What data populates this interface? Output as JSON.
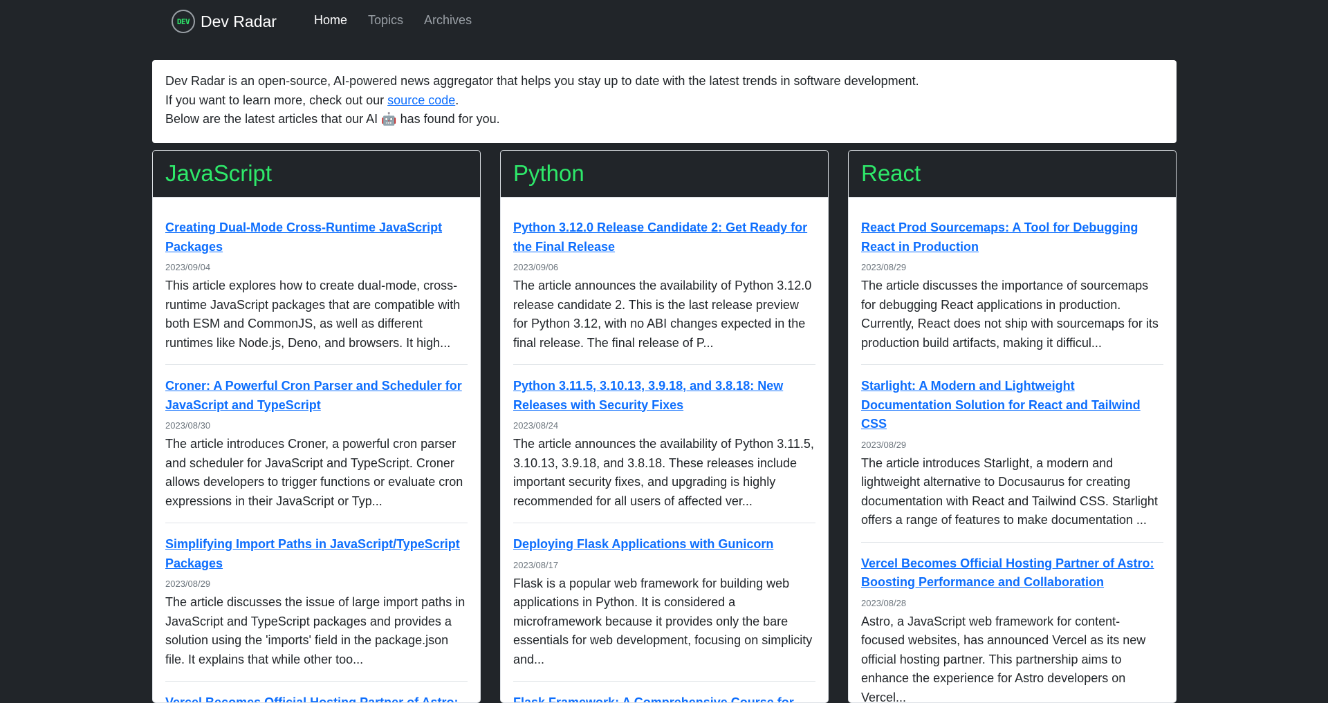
{
  "nav": {
    "logo_text": "DEV",
    "brand": "Dev Radar",
    "links": [
      "Home",
      "Topics",
      "Archives"
    ]
  },
  "intro": {
    "line1": "Dev Radar is an open-source, AI-powered news aggregator that helps you stay up to date with the latest trends in software development.",
    "line2_prefix": "If you want to learn more, check out our ",
    "line2_link": "source code",
    "line2_suffix": ".",
    "line3": "Below are the latest articles that our AI 🤖 has found for you."
  },
  "columns": [
    {
      "title": "JavaScript",
      "articles": [
        {
          "title": "Creating Dual-Mode Cross-Runtime JavaScript Packages",
          "date": "2023/09/04",
          "summary": "This article explores how to create dual-mode, cross-runtime JavaScript packages that are compatible with both ESM and CommonJS, as well as different runtimes like Node.js, Deno, and browsers. It high..."
        },
        {
          "title": "Croner: A Powerful Cron Parser and Scheduler for JavaScript and TypeScript",
          "date": "2023/08/30",
          "summary": "The article introduces Croner, a powerful cron parser and scheduler for JavaScript and TypeScript. Croner allows developers to trigger functions or evaluate cron expressions in their JavaScript or Typ..."
        },
        {
          "title": "Simplifying Import Paths in JavaScript/TypeScript Packages",
          "date": "2023/08/29",
          "summary": "The article discusses the issue of large import paths in JavaScript and TypeScript packages and provides a solution using the 'imports' field in the package.json file. It explains that while other too..."
        },
        {
          "title": "Vercel Becomes Official Hosting Partner of Astro:",
          "date": "",
          "summary": ""
        }
      ]
    },
    {
      "title": "Python",
      "articles": [
        {
          "title": "Python 3.12.0 Release Candidate 2: Get Ready for the Final Release",
          "date": "2023/09/06",
          "summary": "The article announces the availability of Python 3.12.0 release candidate 2. This is the last release preview for Python 3.12, with no ABI changes expected in the final release. The final release of P..."
        },
        {
          "title": "Python 3.11.5, 3.10.13, 3.9.18, and 3.8.18: New Releases with Security Fixes",
          "date": "2023/08/24",
          "summary": "The article announces the availability of Python 3.11.5, 3.10.13, 3.9.18, and 3.8.18. These releases include important security fixes, and upgrading is highly recommended for all users of affected ver..."
        },
        {
          "title": "Deploying Flask Applications with Gunicorn",
          "date": "2023/08/17",
          "summary": "Flask is a popular web framework for building web applications in Python. It is considered a microframework because it provides only the bare essentials for web development, focusing on simplicity and..."
        },
        {
          "title": "Flask Framework: A Comprehensive Course for",
          "date": "",
          "summary": ""
        }
      ]
    },
    {
      "title": "React",
      "articles": [
        {
          "title": "React Prod Sourcemaps: A Tool for Debugging React in Production",
          "date": "2023/08/29",
          "summary": "The article discusses the importance of sourcemaps for debugging React applications in production. Currently, React does not ship with sourcemaps for its production build artifacts, making it difficul..."
        },
        {
          "title": "Starlight: A Modern and Lightweight Documentation Solution for React and Tailwind CSS",
          "date": "2023/08/29",
          "summary": "The article introduces Starlight, a modern and lightweight alternative to Docusaurus for creating documentation with React and Tailwind CSS. Starlight offers a range of features to make documentation ..."
        },
        {
          "title": "Vercel Becomes Official Hosting Partner of Astro: Boosting Performance and Collaboration",
          "date": "2023/08/28",
          "summary": "Astro, a JavaScript web framework for content-focused websites, has announced Vercel as its new official hosting partner. This partnership aims to enhance the experience for Astro developers on Vercel..."
        }
      ]
    }
  ]
}
